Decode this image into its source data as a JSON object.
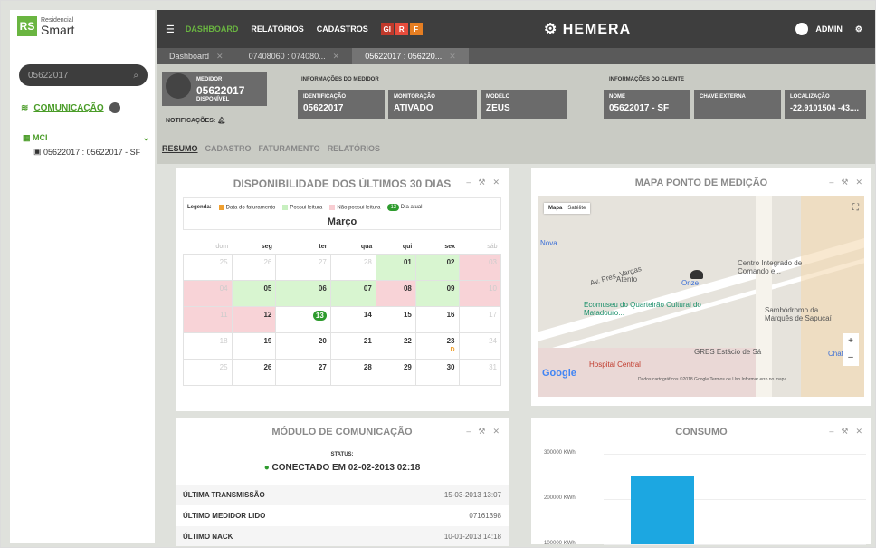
{
  "brand": {
    "logo": "RS",
    "line1": "Residencial",
    "line2": "Smart"
  },
  "sidebar": {
    "search_value": "05622017",
    "section": "COMUNICAÇÃO",
    "group": "MCI",
    "item": "05622017 : 05622017 - SF"
  },
  "topbar": {
    "nav": [
      "DASHBOARD",
      "RELATÓRIOS",
      "CADASTROS"
    ],
    "flags": [
      "GI",
      "R",
      "F"
    ],
    "title": "HEMERA",
    "user": "ADMIN"
  },
  "tabs": [
    "Dashboard",
    "07408060 : 074080...",
    "05622017 : 056220..."
  ],
  "medidor": {
    "label": "MEDIDOR",
    "id": "05622017",
    "state": "DISPONÍVEL",
    "notificacoes": "NOTIFICAÇÕES:"
  },
  "info_medidor": {
    "title": "INFORMAÇÕES DO MEDIDOR",
    "fields": [
      {
        "label": "IDENTIFICAÇÃO",
        "value": "05622017"
      },
      {
        "label": "MONITORAÇÃO",
        "value": "ATIVADO"
      },
      {
        "label": "MODELO",
        "value": "ZEUS"
      }
    ]
  },
  "info_cliente": {
    "title": "INFORMAÇÕES DO CLIENTE",
    "fields": [
      {
        "label": "NOME",
        "value": "05622017 - SF"
      },
      {
        "label": "CHAVE EXTERNA",
        "value": ""
      },
      {
        "label": "LOCALIZAÇÃO",
        "value": "-22.9101504 -43...."
      }
    ]
  },
  "subtabs": [
    "RESUMO",
    "CADASTRO",
    "FATURAMENTO",
    "RELATÓRIOS"
  ],
  "calendar": {
    "title": "DISPONIBILIDADE DOS ÚLTIMOS 30 DIAS",
    "legend_label": "Legenda:",
    "legend": [
      "Data do faturamento",
      "Possui leitura",
      "Não possui leitura"
    ],
    "today_badge": "13",
    "today_label": "Dia atual",
    "month": "Março",
    "days": [
      "dom",
      "seg",
      "ter",
      "qua",
      "qui",
      "sex",
      "sáb"
    ],
    "weeks": [
      [
        "25",
        "26",
        "27",
        "28",
        "01",
        "02",
        "03"
      ],
      [
        "04",
        "05",
        "06",
        "07",
        "08",
        "09",
        "10"
      ],
      [
        "11",
        "12",
        "13",
        "14",
        "15",
        "16",
        "17"
      ],
      [
        "18",
        "19",
        "20",
        "21",
        "22",
        "23",
        "24"
      ],
      [
        "25",
        "26",
        "27",
        "28",
        "29",
        "30",
        "31"
      ]
    ],
    "marker": "D"
  },
  "map": {
    "title": "MAPA PONTO DE MEDIÇÃO",
    "tab_map": "Mapa",
    "tab_sat": "Satélite",
    "labels": [
      "Av. Pres. Vargas",
      "Atento",
      "Centro Integrado de Comando e...",
      "Ecomuseu do Quarteirão Cultural do Matadouro...",
      "Sambódromo da Marquês de Sapucaí",
      "GRES Estácio de Sá",
      "Hospital Central",
      "Onze",
      "Nova",
      "Chaf"
    ],
    "footer": "Dados cartográficos ©2018 Google  Termos de Uso  Informar erro no mapa",
    "google": "Google"
  },
  "comm_module": {
    "title": "MÓDULO DE COMUNICAÇÃO",
    "status_label": "STATUS:",
    "status_value": "CONECTADO EM 02-02-2013 02:18",
    "rows": [
      {
        "k": "ÚLTIMA TRANSMISSÃO",
        "v": "15-03-2013 13:07"
      },
      {
        "k": "ÚLTIMO MEDIDOR LIDO",
        "v": "07161398"
      },
      {
        "k": "ÚLTIMO NACK",
        "v": "10-01-2013 14:18"
      }
    ]
  },
  "consumo": {
    "title": "CONSUMO",
    "ylabels": [
      "300000 KWh",
      "200000 KWh",
      "100000 KWh"
    ]
  },
  "chart_data": {
    "type": "bar",
    "title": "CONSUMO",
    "categories": [
      ""
    ],
    "values": [
      250000
    ],
    "ylabel": "",
    "yticks": [
      100000,
      200000,
      300000
    ],
    "color": "#1ca7e1"
  }
}
